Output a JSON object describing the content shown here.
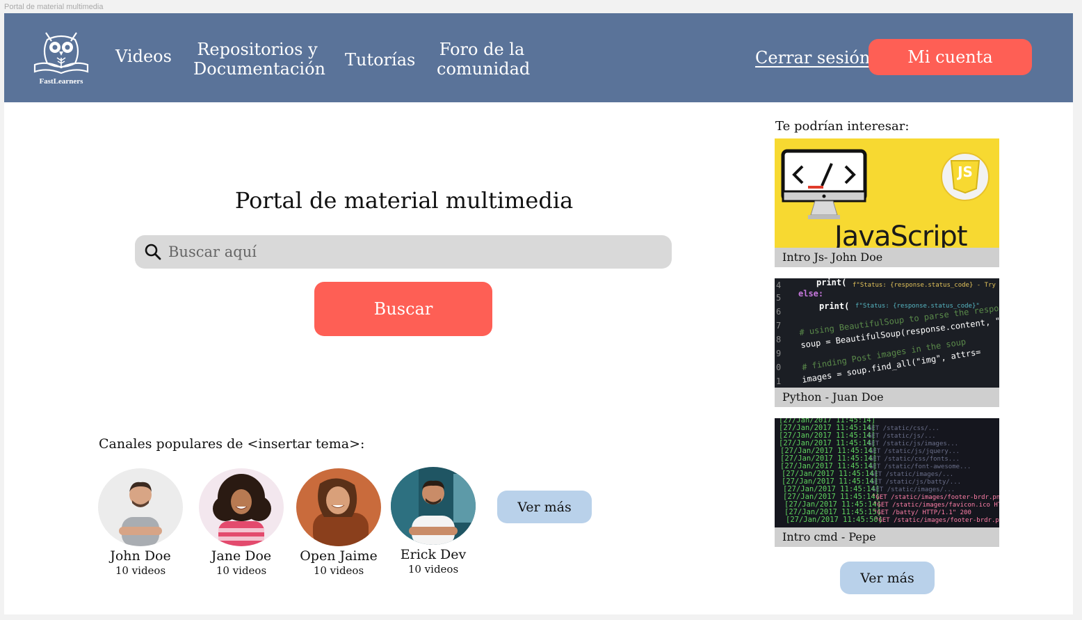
{
  "frame_label": "Portal de material multimedia",
  "header": {
    "logo_text": "FastLearners",
    "nav": {
      "videos": "Videos",
      "repos_line1": "Repositorios y",
      "repos_line2": "Documentación",
      "tutorias": "Tutorías",
      "foro_line1": "Foro de la",
      "foro_line2": "comunidad"
    },
    "logout": "Cerrar sesión",
    "account": "Mi cuenta"
  },
  "main": {
    "title": "Portal de material multimedia",
    "search_placeholder": "Buscar aquí",
    "search_button": "Buscar",
    "channels_heading": "Canales populares de <insertar tema>:",
    "channels": [
      {
        "name": "John Doe",
        "count": "10 videos"
      },
      {
        "name": "Jane Doe",
        "count": "10 videos"
      },
      {
        "name": "Open Jaime",
        "count": "10 videos"
      },
      {
        "name": "Erick Dev",
        "count": "10 videos"
      }
    ],
    "more_button": "Ver más"
  },
  "sidebar": {
    "heading": "Te podrían interesar:",
    "cards": [
      {
        "caption": "Intro Js- John Doe",
        "thumb_text": "JavaScript",
        "badge": "JS"
      },
      {
        "caption": "Python -  Juan Doe"
      },
      {
        "caption": "Intro cmd - Pepe"
      }
    ],
    "more_button": "Ver más"
  },
  "colors": {
    "header_bg": "#5a7399",
    "accent": "#fe5f55",
    "secondary_button": "#b9d1ea",
    "search_bg": "#d9d9d9"
  }
}
